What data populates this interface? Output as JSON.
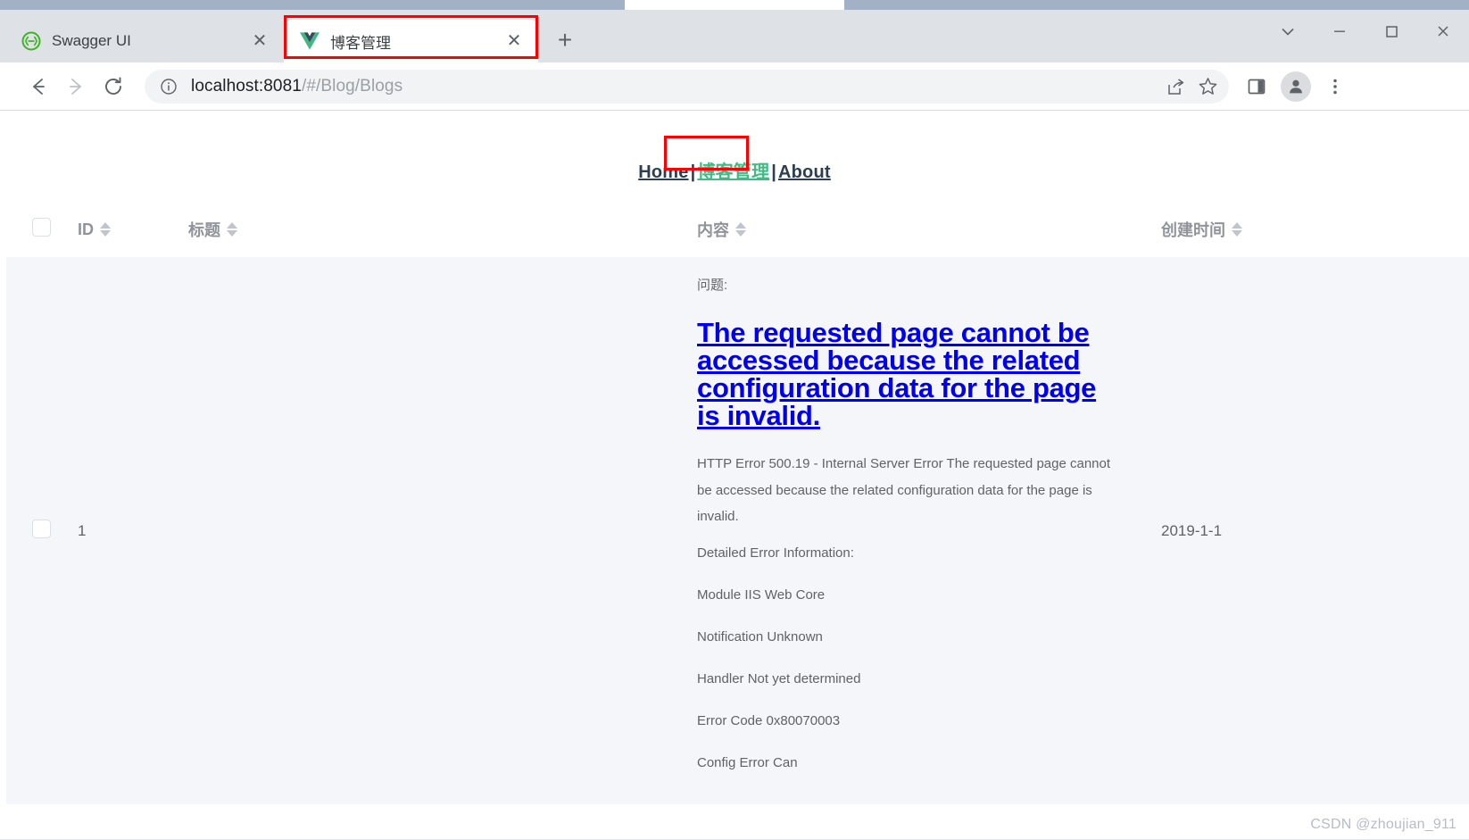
{
  "browser": {
    "tabs": [
      {
        "title": "Swagger UI",
        "favicon": "swagger-icon",
        "active": false,
        "close_label": "✕"
      },
      {
        "title": "博客管理",
        "favicon": "vue-icon",
        "active": true,
        "close_label": "✕"
      }
    ],
    "new_tab_label": "+",
    "window_controls": [
      {
        "name": "tab-search-button",
        "glyph": "⌄"
      },
      {
        "name": "minimize-button",
        "glyph": "—"
      },
      {
        "name": "maximize-button",
        "glyph": "☐"
      },
      {
        "name": "close-window-button",
        "glyph": "✕"
      }
    ],
    "toolbar": {
      "back_label": "←",
      "forward_label": "→",
      "reload_label": "⟳",
      "site_info_icon": "info-circle-icon",
      "url_host": "localhost:8081",
      "url_path": "/#/Blog/Blogs",
      "url_full": "localhost:8081/#/Blog/Blogs",
      "share_icon": "share-icon",
      "bookmark_icon": "star-icon",
      "side_panel_icon": "side-panel-icon",
      "profile_icon": "profile-avatar-icon",
      "menu_icon": "three-dot-menu-icon"
    }
  },
  "page": {
    "nav": {
      "separator": "|",
      "links": [
        {
          "label": "Home",
          "active": false
        },
        {
          "label": "博客管理",
          "active": true
        },
        {
          "label": "About",
          "active": false
        }
      ]
    },
    "table": {
      "columns": [
        {
          "key": "check",
          "label": "",
          "sortable": false
        },
        {
          "key": "id",
          "label": "ID",
          "sortable": true
        },
        {
          "key": "title",
          "label": "标题",
          "sortable": true
        },
        {
          "key": "content",
          "label": "内容",
          "sortable": true
        },
        {
          "key": "date",
          "label": "创建时间",
          "sortable": true
        }
      ],
      "rows": [
        {
          "id": "1",
          "title": "",
          "date": "2019-1-1",
          "content": {
            "label": "问题:",
            "heading": "The requested page cannot be accessed because the related configuration data for the page is invalid.",
            "body": "HTTP Error 500.19 - Internal Server Error The requested page cannot be accessed because the related configuration data for the page is invalid.",
            "lines": [
              "Detailed Error Information:",
              "Module IIS Web Core",
              "Notification Unknown",
              "Handler Not yet determined",
              "Error Code 0x80070003",
              "Config Error Can"
            ]
          }
        }
      ]
    },
    "watermark": "CSDN @zhoujian_911"
  },
  "colors": {
    "accent_green": "#42b983",
    "link_blue": "#0000ee",
    "annotation_red": "#ff0000",
    "nav_text": "#2c3e50",
    "row_bg": "#f4f6f9",
    "header_text": "#909399"
  }
}
